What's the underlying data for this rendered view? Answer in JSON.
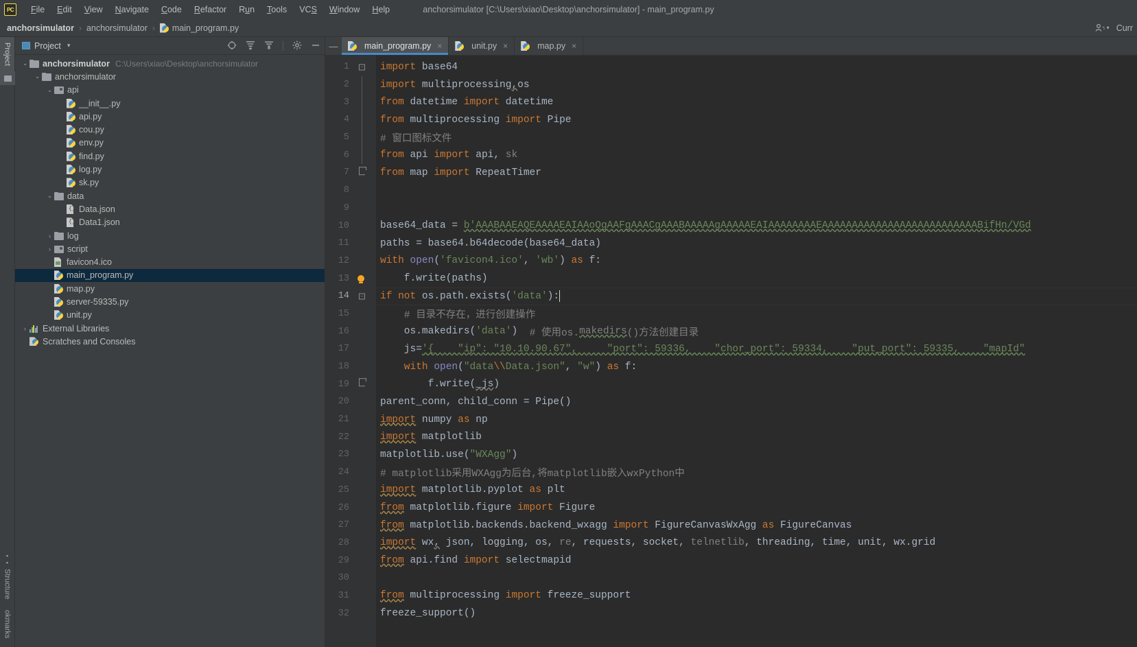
{
  "window": {
    "title": "anchorsimulator [C:\\Users\\xiao\\Desktop\\anchorsimulator] - main_program.py",
    "logo": "PC"
  },
  "menu": [
    {
      "label": "File",
      "mnemonic": "F"
    },
    {
      "label": "Edit",
      "mnemonic": "E"
    },
    {
      "label": "View",
      "mnemonic": "V"
    },
    {
      "label": "Navigate",
      "mnemonic": "N"
    },
    {
      "label": "Code",
      "mnemonic": "C"
    },
    {
      "label": "Refactor",
      "mnemonic": "R"
    },
    {
      "label": "Run",
      "mnemonic": "u"
    },
    {
      "label": "Tools",
      "mnemonic": "T"
    },
    {
      "label": "VCS",
      "mnemonic": "S"
    },
    {
      "label": "Window",
      "mnemonic": "W"
    },
    {
      "label": "Help",
      "mnemonic": "H"
    }
  ],
  "breadcrumb": {
    "items": [
      "anchorsimulator",
      "anchorsimulator",
      "main_program.py"
    ],
    "separator": "›"
  },
  "navbar_right": {
    "user_icon": "user-settings-icon",
    "caret": "▾",
    "current_file_label": "Curr"
  },
  "left_strip": {
    "project_button": "Project",
    "structure_button": "Structure",
    "bookmarks_button": "okmarks"
  },
  "project_panel": {
    "title": "Project",
    "caret": "▾",
    "actions": [
      {
        "name": "select-opened-file-icon",
        "glyph": "⊕"
      },
      {
        "name": "expand-all-icon",
        "glyph": "⨌"
      },
      {
        "name": "collapse-all-icon",
        "glyph": "⨋"
      },
      {
        "name": "settings-gear-icon",
        "glyph": "⚙"
      },
      {
        "name": "hide-panel-icon",
        "glyph": "—"
      }
    ],
    "tree": [
      {
        "indent": 0,
        "arrow": "⌄",
        "icon": "folder",
        "label": "anchorsimulator",
        "bold": true,
        "path": "C:\\Users\\xiao\\Desktop\\anchorsimulator",
        "selected": false
      },
      {
        "indent": 1,
        "arrow": "⌄",
        "icon": "folder",
        "label": "anchorsimulator",
        "bold": false,
        "path": "",
        "selected": false
      },
      {
        "indent": 2,
        "arrow": "⌄",
        "icon": "folder-src",
        "label": "api",
        "bold": false,
        "path": "",
        "selected": false
      },
      {
        "indent": 3,
        "arrow": "",
        "icon": "py",
        "label": "__init__.py",
        "bold": false,
        "path": "",
        "selected": false
      },
      {
        "indent": 3,
        "arrow": "",
        "icon": "py",
        "label": "api.py",
        "bold": false,
        "path": "",
        "selected": false
      },
      {
        "indent": 3,
        "arrow": "",
        "icon": "py",
        "label": "cou.py",
        "bold": false,
        "path": "",
        "selected": false
      },
      {
        "indent": 3,
        "arrow": "",
        "icon": "py",
        "label": "env.py",
        "bold": false,
        "path": "",
        "selected": false
      },
      {
        "indent": 3,
        "arrow": "",
        "icon": "py",
        "label": "find.py",
        "bold": false,
        "path": "",
        "selected": false
      },
      {
        "indent": 3,
        "arrow": "",
        "icon": "py",
        "label": "log.py",
        "bold": false,
        "path": "",
        "selected": false
      },
      {
        "indent": 3,
        "arrow": "",
        "icon": "py",
        "label": "sk.py",
        "bold": false,
        "path": "",
        "selected": false
      },
      {
        "indent": 2,
        "arrow": "⌄",
        "icon": "folder",
        "label": "data",
        "bold": false,
        "path": "",
        "selected": false
      },
      {
        "indent": 3,
        "arrow": "",
        "icon": "json",
        "label": "Data.json",
        "bold": false,
        "path": "",
        "selected": false
      },
      {
        "indent": 3,
        "arrow": "",
        "icon": "json",
        "label": "Data1.json",
        "bold": false,
        "path": "",
        "selected": false
      },
      {
        "indent": 2,
        "arrow": "›",
        "icon": "folder",
        "label": "log",
        "bold": false,
        "path": "",
        "selected": false
      },
      {
        "indent": 2,
        "arrow": "›",
        "icon": "folder-src",
        "label": "script",
        "bold": false,
        "path": "",
        "selected": false
      },
      {
        "indent": 2,
        "arrow": "",
        "icon": "ico",
        "label": "favicon4.ico",
        "bold": false,
        "path": "",
        "selected": false
      },
      {
        "indent": 2,
        "arrow": "",
        "icon": "py",
        "label": "main_program.py",
        "bold": false,
        "path": "",
        "selected": true
      },
      {
        "indent": 2,
        "arrow": "",
        "icon": "py",
        "label": "map.py",
        "bold": false,
        "path": "",
        "selected": false
      },
      {
        "indent": 2,
        "arrow": "",
        "icon": "py",
        "label": "server-59335.py",
        "bold": false,
        "path": "",
        "selected": false
      },
      {
        "indent": 2,
        "arrow": "",
        "icon": "py",
        "label": "unit.py",
        "bold": false,
        "path": "",
        "selected": false
      },
      {
        "indent": 0,
        "arrow": "›",
        "icon": "lib",
        "label": "External Libraries",
        "bold": false,
        "path": "",
        "selected": false
      },
      {
        "indent": 0,
        "arrow": "",
        "icon": "scratch",
        "label": "Scratches and Consoles",
        "bold": false,
        "path": "",
        "selected": false
      }
    ]
  },
  "editor": {
    "tabs": [
      {
        "label": "main_program.py",
        "active": true,
        "close": "×"
      },
      {
        "label": "unit.py",
        "active": false,
        "close": "×"
      },
      {
        "label": "map.py",
        "active": false,
        "close": "×"
      }
    ],
    "hide_tabs_glyph": "—",
    "current_line": 14,
    "lines": [
      {
        "n": 1,
        "gutter": "fold-open",
        "tokens": [
          {
            "t": "import",
            "c": "kw"
          },
          {
            "t": " base64",
            "c": "id"
          }
        ]
      },
      {
        "n": 2,
        "gutter": "bar",
        "tokens": [
          {
            "t": "import",
            "c": "kw"
          },
          {
            "t": " multiprocessing",
            "c": "id"
          },
          {
            "t": ",",
            "c": "id wav-g"
          },
          {
            "t": "os",
            "c": "id"
          }
        ]
      },
      {
        "n": 3,
        "gutter": "bar",
        "tokens": [
          {
            "t": "from",
            "c": "kw"
          },
          {
            "t": " datetime ",
            "c": "id"
          },
          {
            "t": "import",
            "c": "kw"
          },
          {
            "t": " datetime",
            "c": "id"
          }
        ]
      },
      {
        "n": 4,
        "gutter": "bar",
        "tokens": [
          {
            "t": "from",
            "c": "kw"
          },
          {
            "t": " multiprocessing ",
            "c": "id"
          },
          {
            "t": "import",
            "c": "kw"
          },
          {
            "t": " Pipe",
            "c": "id"
          }
        ]
      },
      {
        "n": 5,
        "gutter": "bar",
        "tokens": [
          {
            "t": "# 窗口图标文件",
            "c": "cmt"
          }
        ]
      },
      {
        "n": 6,
        "gutter": "bar",
        "tokens": [
          {
            "t": "from",
            "c": "kw"
          },
          {
            "t": " api ",
            "c": "id"
          },
          {
            "t": "import",
            "c": "kw"
          },
          {
            "t": " api",
            "c": "id"
          },
          {
            "t": ", ",
            "c": "id"
          },
          {
            "t": "sk",
            "c": "gray"
          }
        ]
      },
      {
        "n": 7,
        "gutter": "fold-end",
        "tokens": [
          {
            "t": "from",
            "c": "kw"
          },
          {
            "t": " map ",
            "c": "id"
          },
          {
            "t": "import",
            "c": "kw"
          },
          {
            "t": " RepeatTimer",
            "c": "id"
          }
        ]
      },
      {
        "n": 8,
        "gutter": "",
        "tokens": []
      },
      {
        "n": 9,
        "gutter": "",
        "tokens": []
      },
      {
        "n": 10,
        "gutter": "",
        "tokens": [
          {
            "t": "base64_data = ",
            "c": "id"
          },
          {
            "t": "b'AAABAAEAQEAAAAEAIAAoQgAAFgAAACgAAABAAAAAgAAAAAEAIAAAAAAAAEAAAAAAAAAAAAAAAAAAAAAAAAAABifHn/VGd",
            "c": "str wav"
          }
        ]
      },
      {
        "n": 11,
        "gutter": "",
        "tokens": [
          {
            "t": "paths = base64.b64decode(base64_data)",
            "c": "id"
          }
        ]
      },
      {
        "n": 12,
        "gutter": "",
        "tokens": [
          {
            "t": "with ",
            "c": "kw"
          },
          {
            "t": "open",
            "c": "builtin"
          },
          {
            "t": "(",
            "c": "id"
          },
          {
            "t": "'favicon4.ico'",
            "c": "str"
          },
          {
            "t": ", ",
            "c": "id"
          },
          {
            "t": "'wb'",
            "c": "str"
          },
          {
            "t": ") ",
            "c": "id"
          },
          {
            "t": "as",
            "c": "kw"
          },
          {
            "t": " f:",
            "c": "id"
          }
        ]
      },
      {
        "n": 13,
        "gutter": "bulb",
        "tokens": [
          {
            "t": "    f.write(paths)",
            "c": "id"
          }
        ]
      },
      {
        "n": 14,
        "gutter": "fold-open",
        "tokens": [
          {
            "t": "if not",
            "c": "kw"
          },
          {
            "t": " os.path.exists(",
            "c": "id"
          },
          {
            "t": "'data'",
            "c": "str"
          },
          {
            "t": "):",
            "c": "id"
          }
        ],
        "caret": true
      },
      {
        "n": 15,
        "gutter": "",
        "tokens": [
          {
            "t": "    # 目录不存在，进行创建操作",
            "c": "cmt"
          }
        ]
      },
      {
        "n": 16,
        "gutter": "",
        "tokens": [
          {
            "t": "    os.makedirs(",
            "c": "id"
          },
          {
            "t": "'data'",
            "c": "str"
          },
          {
            "t": ")  ",
            "c": "id"
          },
          {
            "t": "# 使用os.",
            "c": "cmt"
          },
          {
            "t": "makedirs",
            "c": "cmt wav"
          },
          {
            "t": "()方法创建目录",
            "c": "cmt"
          }
        ]
      },
      {
        "n": 17,
        "gutter": "",
        "tokens": [
          {
            "t": "    js=",
            "c": "id"
          },
          {
            "t": "'{    \"ip\": \"10.10.90.67\",     \"port\": 59336,    \"chor_port\": 59334,    \"put_port\": 59335,    \"mapId\"",
            "c": "str wav"
          }
        ]
      },
      {
        "n": 18,
        "gutter": "",
        "tokens": [
          {
            "t": "    with ",
            "c": "kw"
          },
          {
            "t": "open",
            "c": "builtin"
          },
          {
            "t": "(",
            "c": "id"
          },
          {
            "t": "\"data",
            "c": "str"
          },
          {
            "t": "\\\\",
            "c": "kw"
          },
          {
            "t": "Data.json\"",
            "c": "str"
          },
          {
            "t": ", ",
            "c": "id"
          },
          {
            "t": "\"w\"",
            "c": "str"
          },
          {
            "t": ") ",
            "c": "id"
          },
          {
            "t": "as",
            "c": "kw"
          },
          {
            "t": " f:",
            "c": "id"
          }
        ]
      },
      {
        "n": 19,
        "gutter": "fold-end2",
        "tokens": [
          {
            "t": "        f.write(",
            "c": "id"
          },
          {
            "t": "_js",
            "c": "id wav-g"
          },
          {
            "t": ")",
            "c": "id"
          }
        ]
      },
      {
        "n": 20,
        "gutter": "",
        "tokens": [
          {
            "t": "parent_conn, child_conn = Pipe()",
            "c": "id"
          }
        ]
      },
      {
        "n": 21,
        "gutter": "",
        "tokens": [
          {
            "t": "import",
            "c": "kw wav-o"
          },
          {
            "t": " numpy ",
            "c": "id"
          },
          {
            "t": "as",
            "c": "kw"
          },
          {
            "t": " np",
            "c": "id"
          }
        ]
      },
      {
        "n": 22,
        "gutter": "",
        "tokens": [
          {
            "t": "import",
            "c": "kw wav-o"
          },
          {
            "t": " matplotlib",
            "c": "id"
          }
        ]
      },
      {
        "n": 23,
        "gutter": "",
        "tokens": [
          {
            "t": "matplotlib.use(",
            "c": "id"
          },
          {
            "t": "\"WXAgg\"",
            "c": "str"
          },
          {
            "t": ")",
            "c": "id"
          }
        ]
      },
      {
        "n": 24,
        "gutter": "",
        "tokens": [
          {
            "t": "# matplotlib采用WXAgg为后台,将matplotlib嵌入wxPython中",
            "c": "cmt"
          }
        ]
      },
      {
        "n": 25,
        "gutter": "",
        "tokens": [
          {
            "t": "import",
            "c": "kw wav-o"
          },
          {
            "t": " matplotlib.pyplot ",
            "c": "id"
          },
          {
            "t": "as",
            "c": "kw"
          },
          {
            "t": " plt",
            "c": "id"
          }
        ]
      },
      {
        "n": 26,
        "gutter": "",
        "tokens": [
          {
            "t": "from",
            "c": "kw wav-o"
          },
          {
            "t": " matplotlib.figure ",
            "c": "id"
          },
          {
            "t": "import",
            "c": "kw"
          },
          {
            "t": " Figure",
            "c": "id"
          }
        ]
      },
      {
        "n": 27,
        "gutter": "",
        "tokens": [
          {
            "t": "from",
            "c": "kw wav-o"
          },
          {
            "t": " matplotlib.backends.backend_wxagg ",
            "c": "id"
          },
          {
            "t": "import",
            "c": "kw"
          },
          {
            "t": " FigureCanvasWxAgg ",
            "c": "id"
          },
          {
            "t": "as",
            "c": "kw"
          },
          {
            "t": " FigureCanvas",
            "c": "id"
          }
        ]
      },
      {
        "n": 28,
        "gutter": "",
        "tokens": [
          {
            "t": "import",
            "c": "kw wav-o"
          },
          {
            "t": " wx",
            "c": "id"
          },
          {
            "t": ",",
            "c": "id wav-g"
          },
          {
            "t": " json, logging, os, ",
            "c": "id"
          },
          {
            "t": "re",
            "c": "gray"
          },
          {
            "t": ", requests, socket, ",
            "c": "id"
          },
          {
            "t": "telnetlib",
            "c": "gray"
          },
          {
            "t": ", threading, time, unit, wx.grid",
            "c": "id"
          }
        ]
      },
      {
        "n": 29,
        "gutter": "",
        "tokens": [
          {
            "t": "from",
            "c": "kw wav-o"
          },
          {
            "t": " api.find ",
            "c": "id"
          },
          {
            "t": "import",
            "c": "kw"
          },
          {
            "t": " selectmapid",
            "c": "id"
          }
        ]
      },
      {
        "n": 30,
        "gutter": "",
        "tokens": []
      },
      {
        "n": 31,
        "gutter": "",
        "tokens": [
          {
            "t": "from",
            "c": "kw wav-o"
          },
          {
            "t": " multiprocessing ",
            "c": "id"
          },
          {
            "t": "import",
            "c": "kw"
          },
          {
            "t": " freeze_support",
            "c": "id"
          }
        ]
      },
      {
        "n": 32,
        "gutter": "",
        "tokens": [
          {
            "t": "freeze_support()",
            "c": "id"
          }
        ]
      }
    ]
  },
  "colors": {
    "bg_chrome": "#3c3f41",
    "bg_editor": "#2b2b2b",
    "gutter": "#313335",
    "accent_tab": "#4a88c7",
    "selection": "#0d293e",
    "keyword": "#cc7832",
    "string": "#6a8759",
    "comment": "#808080",
    "number": "#6897bb",
    "identifier": "#a9b7c6"
  }
}
